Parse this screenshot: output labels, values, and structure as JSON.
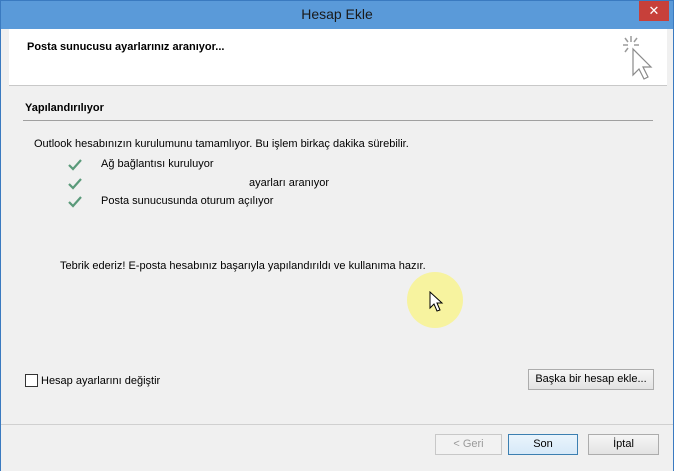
{
  "window": {
    "title": "Hesap Ekle",
    "close_glyph": "✕"
  },
  "header": {
    "title": "Posta sunucusu ayarlarınız aranıyor..."
  },
  "section": {
    "title": "Yapılandırılıyor"
  },
  "intro": "Outlook hesabınızın kurulumunu tamamlıyor. Bu işlem birkaç dakika sürebilir.",
  "steps": [
    {
      "label": "Ağ bağlantısı kuruluyor",
      "status": "done"
    },
    {
      "label": "ayarları aranıyor",
      "status": "done"
    },
    {
      "label": "Posta sunucusunda oturum açılıyor",
      "status": "done"
    }
  ],
  "congrats": "Tebrik ederiz! E-posta hesabınız başarıyla yapılandırıldı ve kullanıma hazır.",
  "options": {
    "change_settings_label": "Hesap ayarlarını değiştir",
    "change_settings_checked": false
  },
  "buttons": {
    "add_another": "Başka bir hesap ekle...",
    "back": "< Geri",
    "finish": "Son",
    "cancel": "İptal"
  },
  "colors": {
    "check": "#5a9a7a",
    "titlebar": "#5a9ad9",
    "close": "#c7403a",
    "highlight": "#f7f396"
  }
}
